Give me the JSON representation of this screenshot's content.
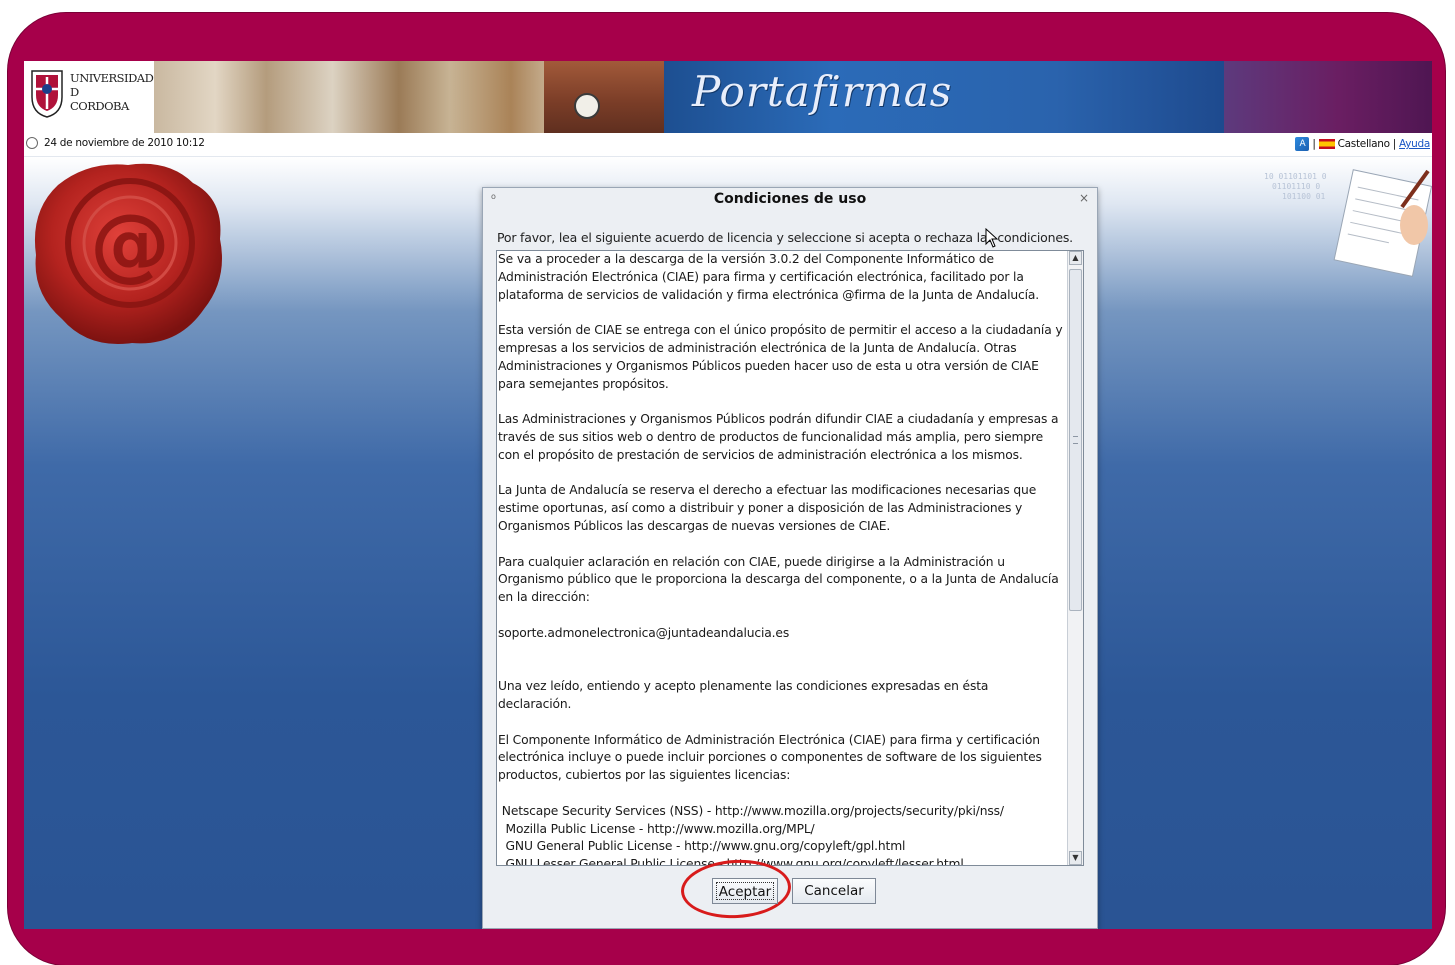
{
  "header": {
    "university_line1": "UNIVERSIDAD",
    "university_line2": "D",
    "university_line3": "CORDOBA",
    "brand": "Portafirmas"
  },
  "datebar": {
    "datetime": "24 de noviembre de 2010 10:12",
    "language": "Castellano",
    "separator": "|",
    "help": "Ayuda"
  },
  "dialog": {
    "title": "Condiciones de uso",
    "intro": "Por favor, lea el siguiente acuerdo de licencia y seleccione si acepta o rechaza las condiciones.",
    "paragraphs": [
      "Se va a proceder a la descarga de la versión 3.0.2 del Componente Informático de Administración Electrónica (CIAE) para firma y certificación electrónica, facilitado por la plataforma de servicios de validación y firma electrónica @firma de la Junta de Andalucía.",
      "Esta versión de CIAE se entrega con el único propósito de permitir el acceso a la ciudadanía y empresas a los servicios de administración electrónica de la Junta de Andalucía. Otras Administraciones y Organismos Públicos pueden hacer uso de esta u otra versión de CIAE para semejantes propósitos.",
      "Las Administraciones y Organismos Públicos podrán difundir CIAE a ciudadanía y empresas a través de sus sitios web o dentro de productos de funcionalidad más amplia, pero siempre con el propósito de prestación de servicios de administración electrónica a los mismos.",
      "La Junta de Andalucía se reserva el derecho a efectuar las modificaciones necesarias que estime oportunas, así como a distribuir y poner a disposición de las Administraciones y Organismos Públicos las descargas de nuevas versiones de CIAE.",
      "Para cualquier aclaración en relación con CIAE, puede dirigirse a la Administración u Organismo público que le proporciona la descarga del componente, o a la Junta de Andalucía en la dirección:",
      "soporte.admonelectronica@juntadeandalucia.es",
      "Una vez leído, entiendo y acepto plenamente las condiciones expresadas en ésta declaración.",
      "El Componente Informático de Administración Electrónica (CIAE) para firma y certificación electrónica incluye o puede incluir porciones o componentes de software de los siguientes productos, cubiertos por las siguientes licencias:"
    ],
    "licenses": [
      " Netscape Security Services (NSS) - http://www.mozilla.org/projects/security/pki/nss/",
      "  Mozilla Public License - http://www.mozilla.org/MPL/",
      "  GNU General Public License - http://www.gnu.org/copyleft/gpl.html",
      "  GNU Lesser General Public License - http://www.gnu.org/copyleft/lesser.html"
    ],
    "accept_label": "Aceptar",
    "cancel_label": "Cancelar"
  },
  "colors": {
    "frame": "#a6004a",
    "highlight_ring": "#d81b1b",
    "background_blue": "#2c5797"
  },
  "icons": [
    "clock-icon",
    "accessibility-icon",
    "spain-flag-icon",
    "close-icon",
    "menu-icon",
    "scroll-up-icon",
    "scroll-down-icon",
    "cursor-icon"
  ]
}
